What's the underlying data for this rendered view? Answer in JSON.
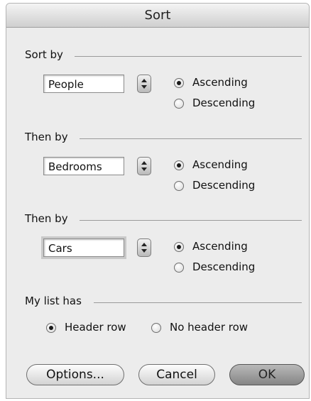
{
  "window": {
    "title": "Sort"
  },
  "sections": [
    {
      "label": "Sort by",
      "field_value": "People",
      "options": [
        "Ascending",
        "Descending"
      ],
      "selected": "Ascending"
    },
    {
      "label": "Then by",
      "field_value": "Bedrooms",
      "options": [
        "Ascending",
        "Descending"
      ],
      "selected": "Ascending"
    },
    {
      "label": "Then by",
      "field_value": "Cars",
      "options": [
        "Ascending",
        "Descending"
      ],
      "selected": "Ascending"
    }
  ],
  "list_header": {
    "label": "My list has",
    "options": [
      "Header row",
      "No header row"
    ],
    "selected": "Header row"
  },
  "buttons": {
    "options": "Options...",
    "cancel": "Cancel",
    "ok": "OK"
  }
}
